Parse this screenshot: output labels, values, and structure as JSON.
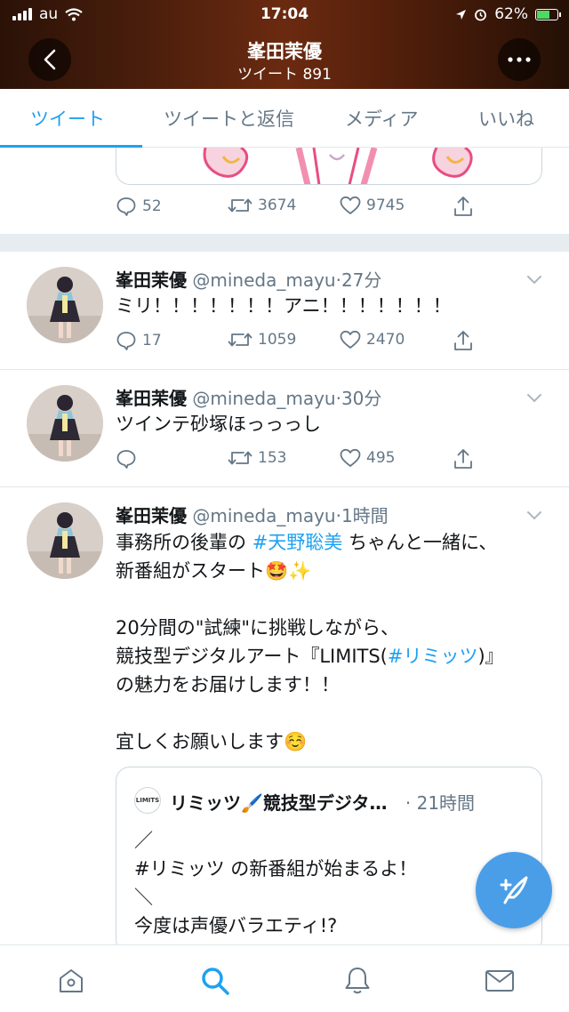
{
  "status_bar": {
    "carrier": "au",
    "time": "17:04",
    "battery": "62%"
  },
  "header": {
    "title": "峯田茉優",
    "subtitle": "ツイート 891"
  },
  "tabs": [
    {
      "label": "ツイート",
      "active": true
    },
    {
      "label": "ツイートと返信",
      "active": false
    },
    {
      "label": "メディア",
      "active": false
    },
    {
      "label": "いいね",
      "active": false
    }
  ],
  "partial_tweet": {
    "replies": "52",
    "retweets": "3674",
    "likes": "9745"
  },
  "tweets": [
    {
      "name": "峯田茉優",
      "handle": "@mineda_mayu",
      "time": "27分",
      "text": "ミリ！！！！！！！アニ！！！！！！！",
      "replies": "17",
      "retweets": "1059",
      "likes": "2470"
    },
    {
      "name": "峯田茉優",
      "handle": "@mineda_mayu",
      "time": "30分",
      "text": "ツインテ砂塚ほっっっし",
      "replies": "",
      "retweets": "153",
      "likes": "495"
    },
    {
      "name": "峯田茉優",
      "handle": "@mineda_mayu",
      "time": "1時間",
      "text_parts": {
        "l1_a": "事務所の後輩の ",
        "l1_tag": "#天野聡美",
        "l1_b": " ちゃんと一緒に、",
        "l2": "新番組がスタート🤩✨",
        "l3": "20分間の\"試練\"に挑戦しながら、",
        "l4_a": "競技型デジタルアート『LIMITS(",
        "l4_tag": "#リミッツ",
        "l4_b": ")』",
        "l5": "の魅力をお届けします！！",
        "l6": "宜しくお願いします☺️"
      },
      "quote": {
        "avatar_text": "LIMITS",
        "name": "リミッツ🖌️競技型デジタ…",
        "time": "· 21時間",
        "lines": [
          "／",
          "#リミッツ の新番組が始まるよ！",
          "＼",
          "今度は声優バラエティ!?"
        ]
      }
    }
  ],
  "colors": {
    "accent": "#1da1f2",
    "muted": "#657786",
    "divider": "#e1e8ed"
  },
  "icons": {
    "nav": [
      "home-icon",
      "search-icon",
      "bell-icon",
      "mail-icon"
    ],
    "actions": [
      "reply-icon",
      "retweet-icon",
      "like-icon",
      "share-icon"
    ]
  }
}
